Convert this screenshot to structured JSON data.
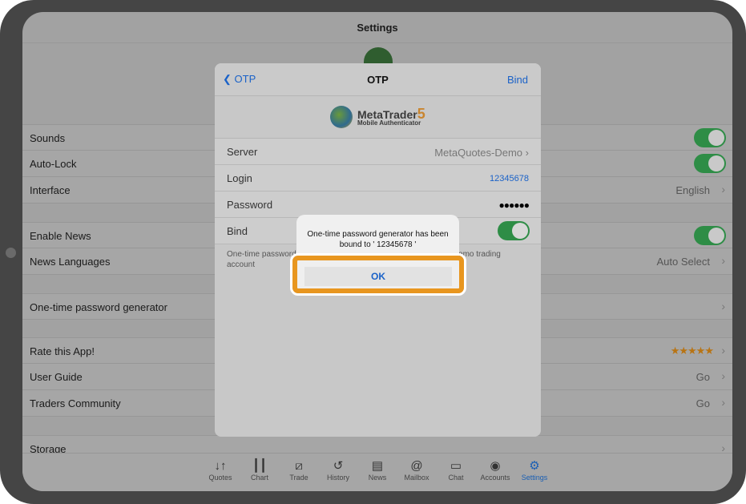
{
  "settings": {
    "title": "Settings",
    "rows": {
      "sounds": "Sounds",
      "autolock": "Auto-Lock",
      "interface": "Interface",
      "interface_value": "English",
      "enable_news": "Enable News",
      "news_languages": "News Languages",
      "news_languages_value": "Auto Select",
      "otp": "One-time password generator",
      "rate": "Rate this App!",
      "rating_stars": "★★★★★",
      "guide": "User Guide",
      "guide_value": "Go",
      "community": "Traders Community",
      "community_value": "Go",
      "storage": "Storage"
    },
    "toggles": {
      "sounds": true,
      "autolock": true,
      "enable_news": true
    }
  },
  "tabs": [
    {
      "label": "Quotes",
      "icon": "↓↑"
    },
    {
      "label": "Chart",
      "icon": "┃┃"
    },
    {
      "label": "Trade",
      "icon": "⧄"
    },
    {
      "label": "History",
      "icon": "↺"
    },
    {
      "label": "News",
      "icon": "▤"
    },
    {
      "label": "Mailbox",
      "icon": "@"
    },
    {
      "label": "Chat",
      "icon": "▭"
    },
    {
      "label": "Accounts",
      "icon": "◉"
    },
    {
      "label": "Settings",
      "icon": "⚙"
    }
  ],
  "modal": {
    "back": "OTP",
    "title": "OTP",
    "action": "Bind",
    "brand": "MetaTrader",
    "brand_num": "5",
    "brand_sub": "Mobile Authenticator",
    "server_label": "Server",
    "server_value": "MetaQuotes-Demo",
    "login_label": "Login",
    "login_value": "12345678",
    "password_label": "Password",
    "password_value": "●●●●●●",
    "bind_label": "Bind",
    "bind_on": true,
    "footer": "One-time password generator will be bound to the MetaQuotes-Demo trading account"
  },
  "alert": {
    "message": "One-time password generator has been bound to ' 12345678 '",
    "ok": "OK",
    "highlight_color": "#e8961f"
  },
  "colors": {
    "accent": "#1a62c8",
    "toggle": "#2e8d46"
  }
}
